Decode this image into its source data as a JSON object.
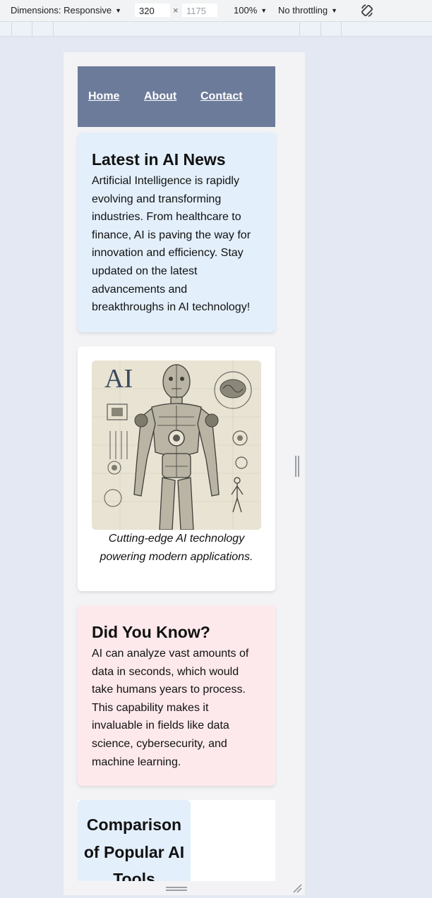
{
  "devtools": {
    "dimensions_label": "Dimensions: Responsive",
    "width_value": "320",
    "height_placeholder": "1175",
    "times": "×",
    "zoom": "100%",
    "throttling": "No throttling"
  },
  "nav": {
    "items": [
      {
        "label": "Home"
      },
      {
        "label": "About"
      },
      {
        "label": "Contact"
      }
    ]
  },
  "news": {
    "heading": "Latest in AI News",
    "body": "Artificial Intelligence is rapidly evolving and transforming industries. From healthcare to finance, AI is paving the way for innovation and efficiency. Stay updated on the latest advancements and breakthroughs in AI technology!"
  },
  "figure": {
    "image_text": "AI",
    "caption": "Cutting-edge AI technology powering modern applications."
  },
  "did_you_know": {
    "heading": "Did You Know?",
    "body": "AI can analyze vast amounts of data in seconds, which would take humans years to process. This capability makes it invaluable in fields like data science, cybersecurity, and machine learning."
  },
  "comparison": {
    "heading": "Comparison of Popular AI Tools"
  }
}
